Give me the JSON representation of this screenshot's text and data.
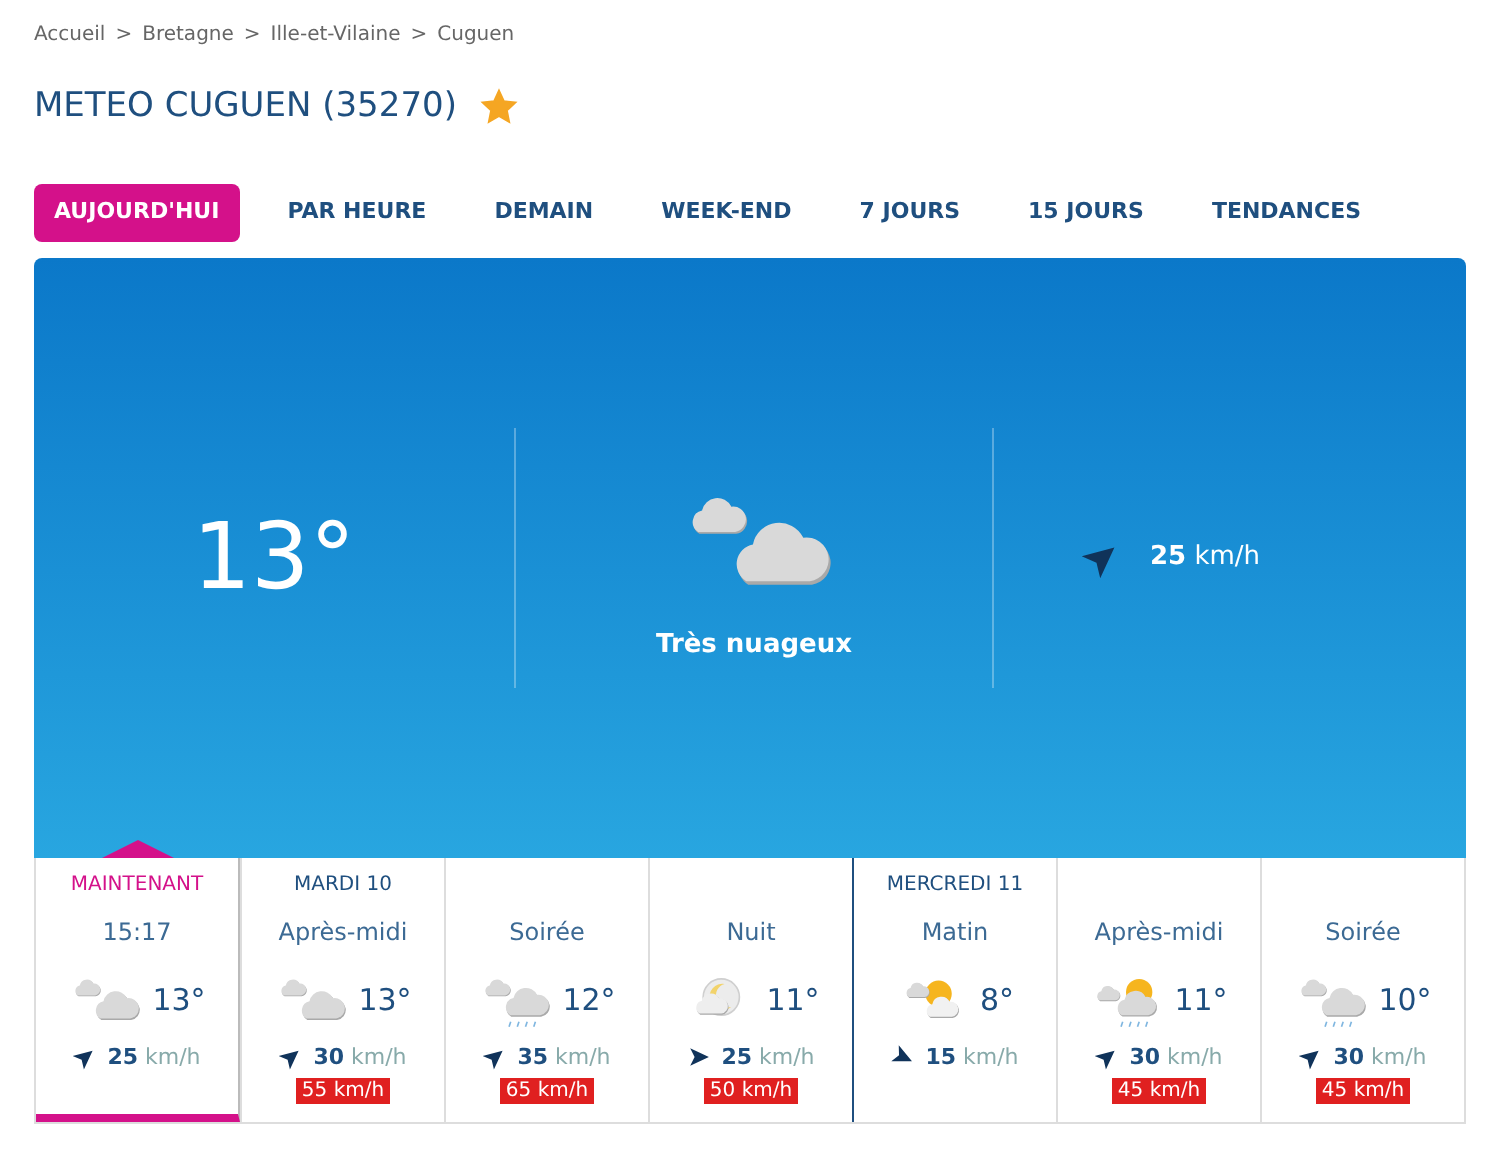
{
  "breadcrumb": [
    "Accueil",
    "Bretagne",
    "Ille-et-Vilaine",
    "Cuguen"
  ],
  "breadcrumb_separator": ">",
  "title": "METEO CUGUEN (35270)",
  "favorite": true,
  "tabs": [
    {
      "label": "AUJOURD'HUI",
      "selected": true
    },
    {
      "label": "PAR HEURE",
      "selected": false
    },
    {
      "label": "DEMAIN",
      "selected": false
    },
    {
      "label": "WEEK-END",
      "selected": false
    },
    {
      "label": "7 JOURS",
      "selected": false
    },
    {
      "label": "15 JOURS",
      "selected": false
    },
    {
      "label": "TENDANCES",
      "selected": false
    }
  ],
  "current": {
    "temperature": "13°",
    "sky": {
      "kind": "clouds"
    },
    "condition": "Très nuageux",
    "wind_arrow": {
      "kind": "northeast"
    },
    "wind_speed": "25",
    "wind_unit": "km/h"
  },
  "forecast": [
    {
      "day": "MAINTENANT",
      "period": "15:17",
      "selected": true,
      "sky": {
        "kind": "clouds"
      },
      "temperature": "13°",
      "wind_arrow": {
        "kind": "northeast"
      },
      "wind_speed": "25",
      "wind_unit": "km/h"
    },
    {
      "day": "MARDI 10",
      "period": "Après-midi",
      "selected": false,
      "new_day": false,
      "sky": {
        "kind": "clouds"
      },
      "temperature": "13°",
      "wind_arrow": {
        "kind": "northeast"
      },
      "wind_speed": "30",
      "wind_unit": "km/h",
      "gust": "55 km/h"
    },
    {
      "period": "Soirée",
      "selected": false,
      "new_day": false,
      "sky": {
        "kind": "rain"
      },
      "temperature": "12°",
      "wind_arrow": {
        "kind": "northeast"
      },
      "wind_speed": "35",
      "wind_unit": "km/h",
      "gust": "65 km/h"
    },
    {
      "period": "Nuit",
      "selected": false,
      "new_day": false,
      "sky": {
        "kind": "moon"
      },
      "temperature": "11°",
      "wind_arrow": {
        "kind": "east"
      },
      "wind_speed": "25",
      "wind_unit": "km/h",
      "gust": "50 km/h"
    },
    {
      "day": "MERCREDI 11",
      "period": "Matin",
      "selected": false,
      "new_day": true,
      "sky": {
        "kind": "sun"
      },
      "temperature": "8°",
      "wind_arrow": {
        "kind": "southeast"
      },
      "wind_speed": "15",
      "wind_unit": "km/h"
    },
    {
      "period": "Après-midi",
      "selected": false,
      "new_day": false,
      "sky": {
        "kind": "sunrain"
      },
      "temperature": "11°",
      "wind_arrow": {
        "kind": "northeast"
      },
      "wind_speed": "30",
      "wind_unit": "km/h",
      "gust": "45 km/h"
    },
    {
      "period": "Soirée",
      "selected": false,
      "new_day": false,
      "sky": {
        "kind": "rain"
      },
      "temperature": "10°",
      "wind_arrow": {
        "kind": "northeast"
      },
      "wind_speed": "30",
      "wind_unit": "km/h",
      "gust": "45 km/h"
    }
  ]
}
